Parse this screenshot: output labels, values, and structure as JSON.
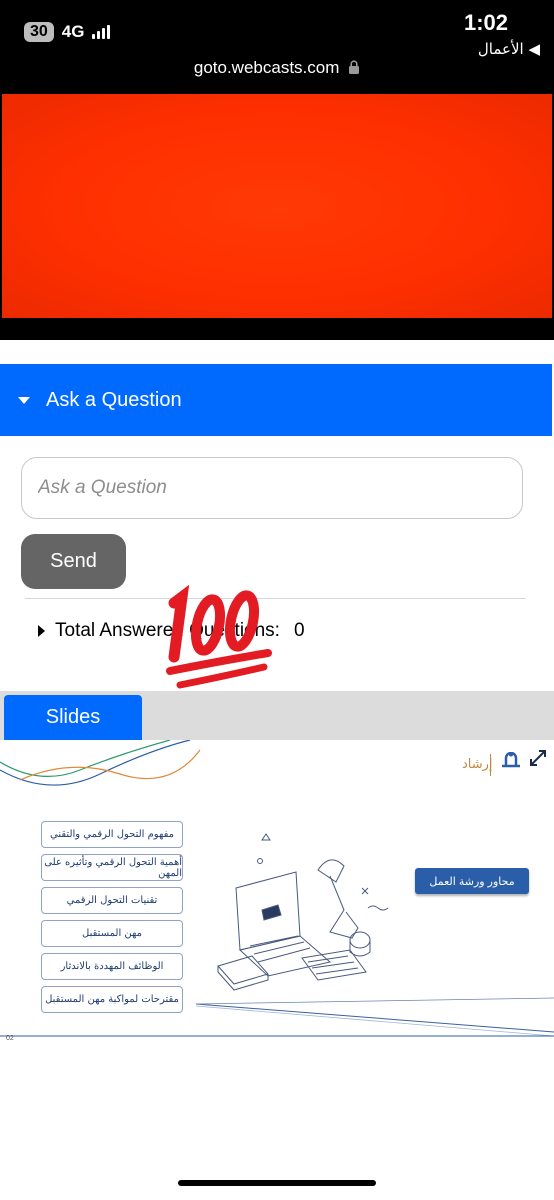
{
  "status_bar": {
    "battery": "30",
    "network": "4G",
    "time": "1:02",
    "back_app": "◀ الأعمال",
    "url": "goto.webcasts.com"
  },
  "ask_panel": {
    "header_title": "Ask a Question",
    "input_placeholder": "Ask a Question",
    "send_label": "Send",
    "answered_label": "Total Answered Questions:",
    "answered_count": "0"
  },
  "tabs": {
    "slides_label": "Slides"
  },
  "slide": {
    "brand": "إرشاد",
    "tag": "محاور ورشة العمل",
    "items": [
      "مفهوم التحول الرقمي والتقني",
      "أهمية التحول الرقمي وتأثيره على المهن",
      "تقنيات التحول الرقمي",
      "مهن المستقبل",
      "الوظائف المهددة بالاندثار",
      "مقترحات لمواكبة مهن المستقبل"
    ],
    "page_number": "02"
  },
  "colors": {
    "accent": "#006aff",
    "video": "#ff3300",
    "send_button": "#656565"
  },
  "icons": [
    "caret-down-icon",
    "lock-icon",
    "caret-right-icon",
    "hundred-points-emoji",
    "expand-icon"
  ]
}
